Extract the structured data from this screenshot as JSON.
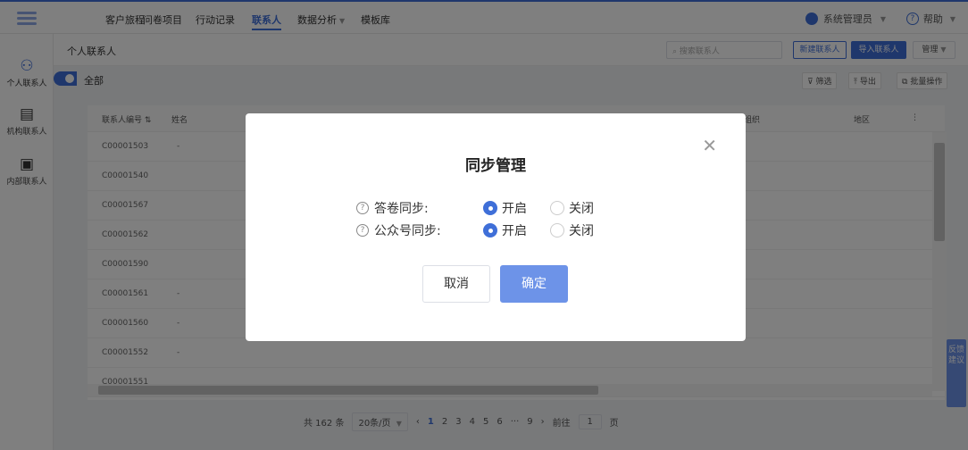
{
  "topnav": {
    "items": [
      {
        "label": "客户旅程"
      },
      {
        "label": "问卷项目"
      },
      {
        "label": "行动记录"
      },
      {
        "label": "联系人"
      },
      {
        "label": "数据分析"
      },
      {
        "label": "模板库"
      }
    ],
    "user": "系统管理员",
    "help": "帮助"
  },
  "sidebar": {
    "items": [
      {
        "label": "个人联系人"
      },
      {
        "label": "机构联系人"
      },
      {
        "label": "内部联系人"
      }
    ]
  },
  "subheader": {
    "title": "个人联系人",
    "search_placeholder": "搜索联系人",
    "new_contact": "新建联系人",
    "import_contact": "导入联系人",
    "manage": "管理"
  },
  "filterbar": {
    "all": "全部",
    "filter": "筛选",
    "export": "导出",
    "batch": "批量操作"
  },
  "table": {
    "headers": [
      "联系人编号",
      "姓名",
      "组织",
      "地区"
    ],
    "rows": [
      {
        "id": "C00001503",
        "name": "-"
      },
      {
        "id": "C00001540",
        "name": ""
      },
      {
        "id": "C00001567",
        "name": ""
      },
      {
        "id": "C00001562",
        "name": ""
      },
      {
        "id": "C00001590",
        "name": ""
      },
      {
        "id": "C00001561",
        "name": "-"
      },
      {
        "id": "C00001560",
        "name": "-"
      },
      {
        "id": "C00001552",
        "name": "-"
      },
      {
        "id": "C00001551",
        "name": ""
      }
    ]
  },
  "pager": {
    "total": "共 162 条",
    "pagesize": "20条/页",
    "pages": [
      "1",
      "2",
      "3",
      "4",
      "5",
      "6",
      "···",
      "9"
    ],
    "goto": "前往",
    "goto_value": "1",
    "page_unit": "页"
  },
  "feedback": "反馈建议",
  "modal": {
    "title": "同步管理",
    "questionnaire_label": "答卷同步:",
    "official_label": "公众号同步:",
    "on": "开启",
    "off": "关闭",
    "cancel": "取消",
    "confirm": "确定"
  },
  "colors": {
    "accent": "#3f6fd8",
    "confirm": "#6d93e8"
  }
}
